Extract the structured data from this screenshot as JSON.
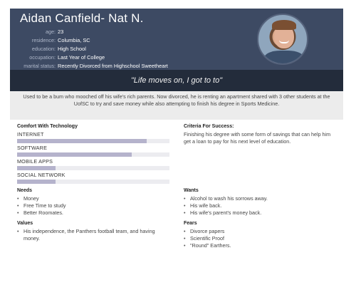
{
  "header": {
    "name": "Aidan Canfield- Nat N.",
    "fields": [
      {
        "label": "age:",
        "value": "23"
      },
      {
        "label": "residence:",
        "value": "Columbia, SC"
      },
      {
        "label": "education:",
        "value": "High School"
      },
      {
        "label": "occupation:",
        "value": "Last Year of College"
      },
      {
        "label": "marital status:",
        "value": "Recently Divorced from Highschool Sweetheart"
      }
    ]
  },
  "quote": "\"Life moves on, I got to to\"",
  "bio": "Used to be a bum who mooched off his wife's rich parents. Now divorced, he is renting an apartment shared with 3 other students at the UofSC to try and save money while also attempting to finish his degree in Sports Medicine.",
  "comfort": {
    "title": "Comfort With Technology",
    "skills": [
      {
        "label": "INTERNET",
        "level": 0.85
      },
      {
        "label": "SOFTWARE",
        "level": 0.75
      },
      {
        "label": "MOBILE APPS",
        "level": 0.25
      },
      {
        "label": "SOCIAL NETWORK",
        "level": 0.25
      }
    ]
  },
  "criteria": {
    "title": "Criteria For Success:",
    "text": "Finishing his degree with some form of savings that can help him get a loan to pay for his next level of education."
  },
  "needs": {
    "title": "Needs",
    "items": [
      "Money",
      "Free Time to study",
      "Better Roomates."
    ]
  },
  "wants": {
    "title": "Wants",
    "items": [
      "Alcohol to wash his sorrows away.",
      "His wife back.",
      "His wife's parent's money back."
    ]
  },
  "values": {
    "title": "Values",
    "items": [
      "His independence, the Panthers football team, and having money."
    ]
  },
  "fears": {
    "title": "Fears",
    "items": [
      "Divorce papers",
      "Scientific Proof",
      "\"Round\" Earthers."
    ]
  },
  "colors": {
    "header": "#3d4a63",
    "quote_bar": "#232c3b",
    "bio_bg": "#ececec",
    "skill_fill": "#b5b3cc"
  }
}
